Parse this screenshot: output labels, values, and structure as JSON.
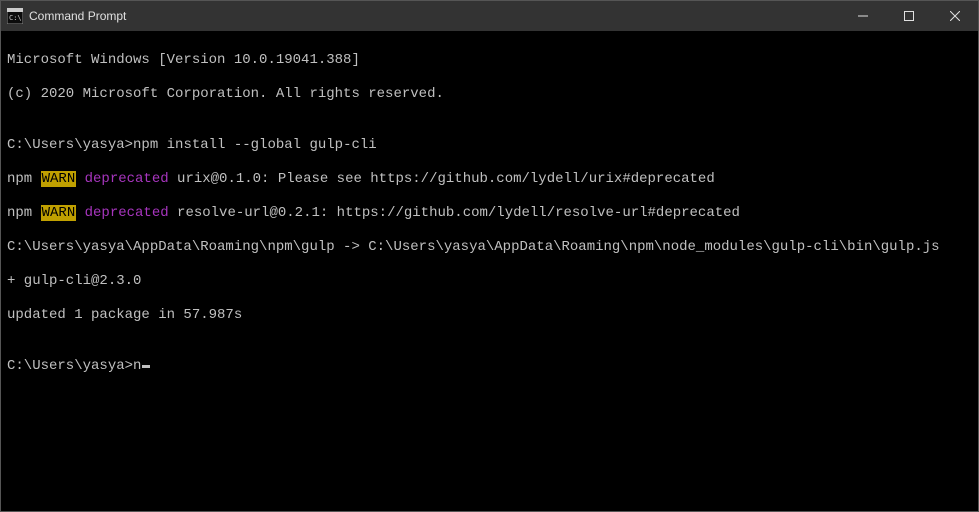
{
  "window": {
    "title": "Command Prompt"
  },
  "terminal": {
    "line1": "Microsoft Windows [Version 10.0.19041.388]",
    "line2": "(c) 2020 Microsoft Corporation. All rights reserved.",
    "blank1": "",
    "command_line": {
      "prompt": "C:\\Users\\yasya>",
      "command": "npm install --global gulp-cli"
    },
    "warn1": {
      "prefix": "npm ",
      "warn": "WARN",
      "space": " ",
      "deprecated": "deprecated",
      "rest": " urix@0.1.0: Please see https://github.com/lydell/urix#deprecated"
    },
    "warn2": {
      "prefix": "npm ",
      "warn": "WARN",
      "space": " ",
      "deprecated": "deprecated",
      "rest": " resolve-url@0.2.1: https://github.com/lydell/resolve-url#deprecated"
    },
    "line3": "C:\\Users\\yasya\\AppData\\Roaming\\npm\\gulp -> C:\\Users\\yasya\\AppData\\Roaming\\npm\\node_modules\\gulp-cli\\bin\\gulp.js",
    "line4": "+ gulp-cli@2.3.0",
    "line5": "updated 1 package in 57.987s",
    "blank2": "",
    "current_prompt": {
      "prompt": "C:\\Users\\yasya>",
      "typed": "n"
    }
  }
}
